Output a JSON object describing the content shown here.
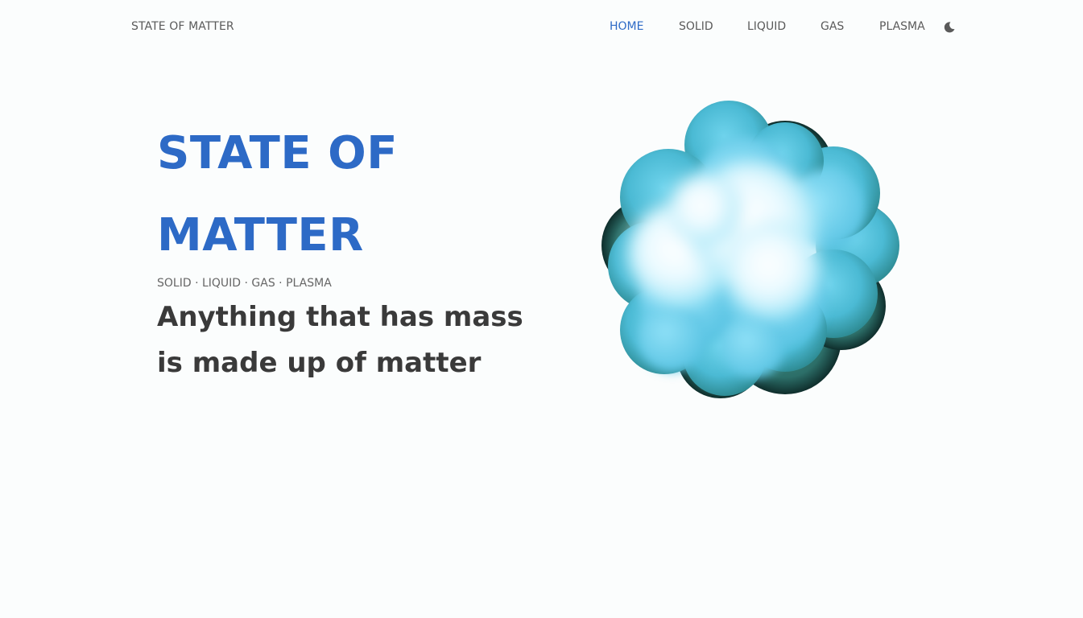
{
  "navbar": {
    "brand": "STATE OF MATTER",
    "links": [
      {
        "label": "HOME",
        "active": true
      },
      {
        "label": "SOLID",
        "active": false
      },
      {
        "label": "LIQUID",
        "active": false
      },
      {
        "label": "GAS",
        "active": false
      },
      {
        "label": "PLASMA",
        "active": false
      }
    ],
    "theme_toggle_icon": "moon-icon"
  },
  "hero": {
    "title_line1": "STATE OF",
    "title_line2": "MATTER",
    "states": "SOLID · LIQUID · GAS · PLASMA",
    "tagline_line1": "Anything that has mass",
    "tagline_line2": "is made up of matter"
  },
  "colors": {
    "accent": "#2d6ac6",
    "text": "#3a3a3a",
    "muted": "#5a5a5a",
    "background": "#fbfdfd"
  }
}
